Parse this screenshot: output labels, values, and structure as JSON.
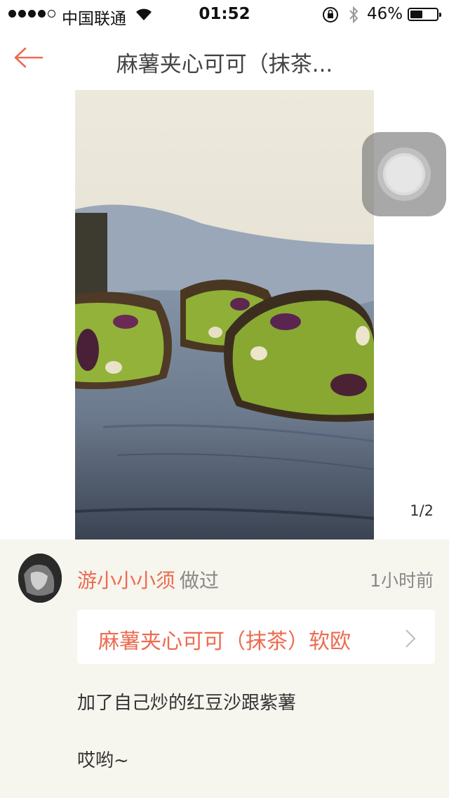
{
  "status_bar": {
    "carrier": "中国联通",
    "time": "01:52",
    "battery": "46%",
    "battery_level": 0.46
  },
  "nav": {
    "title": "麻薯夹心可可（抹茶..."
  },
  "gallery": {
    "page_indicator": "1/2"
  },
  "comment": {
    "user_name": "游小小小须",
    "action": "做过",
    "time_ago": "1小时前",
    "recipe_title": "麻薯夹心可可（抹茶）软欧",
    "lines": [
      "加了自己炒的红豆沙跟紫薯",
      "哎哟~"
    ]
  },
  "colors": {
    "accent": "#ec6b50",
    "background": "#f6f5ee"
  }
}
